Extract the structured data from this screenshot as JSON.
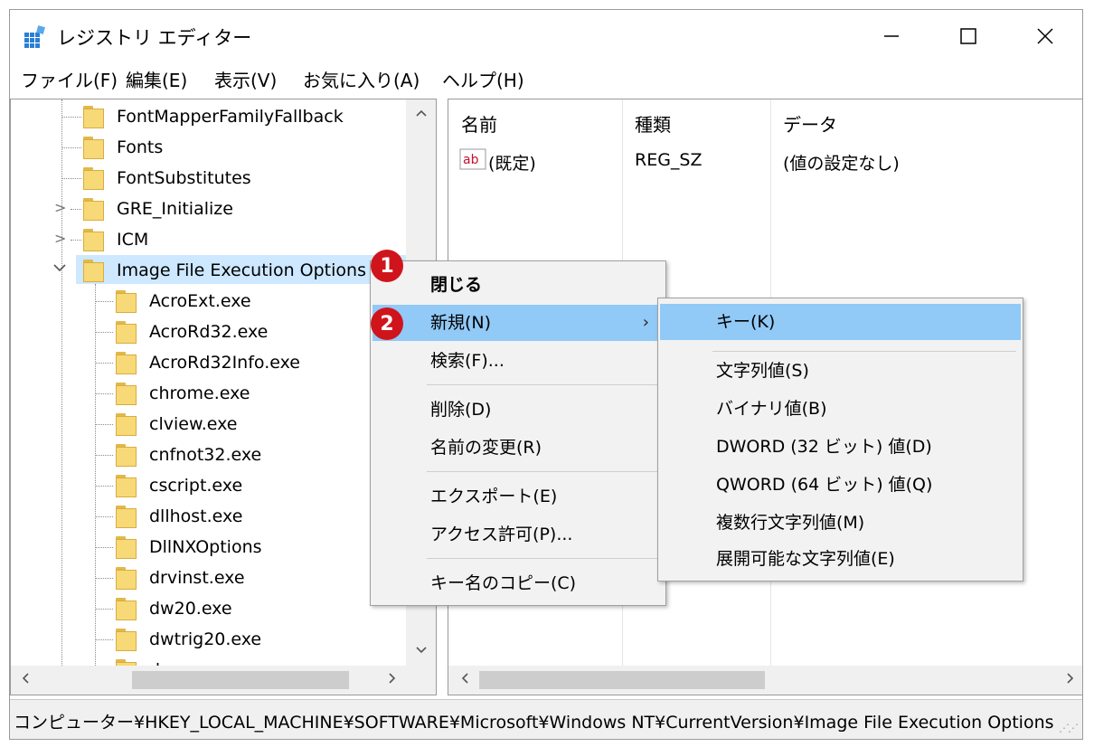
{
  "window": {
    "title": "レジストリ エディター"
  },
  "menubar": [
    "ファイル(F)",
    "編集(E)",
    "表示(V)",
    "お気に入り(A)",
    "ヘルプ(H)"
  ],
  "tree": {
    "items": [
      {
        "label": "FontMapperFamilyFallback"
      },
      {
        "label": "Fonts"
      },
      {
        "label": "FontSubstitutes"
      },
      {
        "label": "GRE_Initialize"
      },
      {
        "label": "ICM"
      },
      {
        "label": "Image File Execution Options"
      },
      {
        "label": "AcroExt.exe"
      },
      {
        "label": "AcroRd32.exe"
      },
      {
        "label": "AcroRd32Info.exe"
      },
      {
        "label": "chrome.exe"
      },
      {
        "label": "clview.exe"
      },
      {
        "label": "cnfnot32.exe"
      },
      {
        "label": "cscript.exe"
      },
      {
        "label": "dllhost.exe"
      },
      {
        "label": "DllNXOptions"
      },
      {
        "label": "drvinst.exe"
      },
      {
        "label": "dw20.exe"
      },
      {
        "label": "dwtrig20.exe"
      },
      {
        "label": "dxpserver.exe"
      }
    ]
  },
  "list": {
    "headers": [
      "名前",
      "種類",
      "データ"
    ],
    "rows": [
      {
        "name": "(既定)",
        "type": "REG_SZ",
        "data": "(値の設定なし)",
        "icon": "ab"
      }
    ]
  },
  "context_menu": {
    "items": [
      "閉じる",
      "新規(N)",
      "検索(F)...",
      "削除(D)",
      "名前の変更(R)",
      "エクスポート(E)",
      "アクセス許可(P)...",
      "キー名のコピー(C)"
    ]
  },
  "submenu": {
    "items": [
      "キー(K)",
      "文字列値(S)",
      "バイナリ値(B)",
      "DWORD (32 ビット) 値(D)",
      "QWORD (64 ビット) 値(Q)",
      "複数行文字列値(M)",
      "展開可能な文字列値(E)"
    ]
  },
  "badges": [
    "1",
    "2"
  ],
  "status": {
    "path": "コンピューター¥HKEY_LOCAL_MACHINE¥SOFTWARE¥Microsoft¥Windows NT¥CurrentVersion¥Image File Execution Options"
  },
  "colors": {
    "highlight": "#91c9f7",
    "selection": "#cde8ff",
    "badge": "#d0141b",
    "folder": "#f7d977",
    "accent": "#0078d7"
  }
}
